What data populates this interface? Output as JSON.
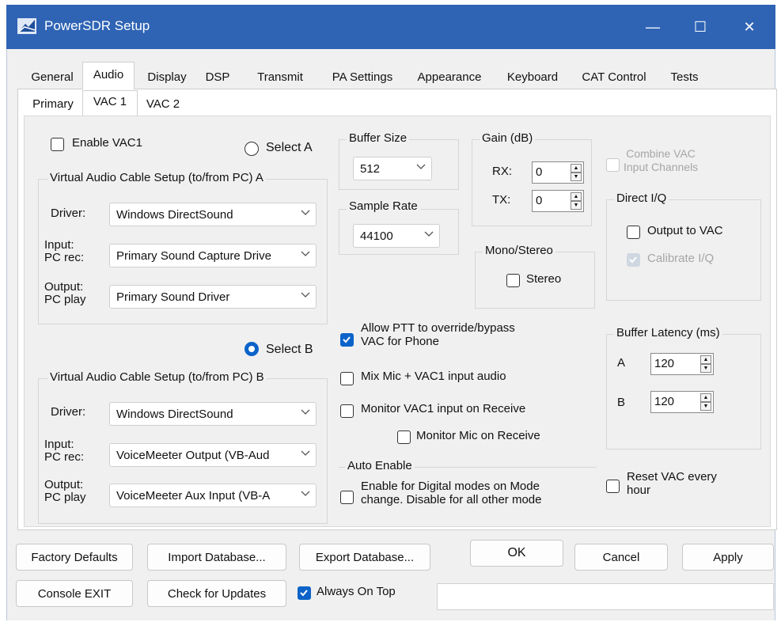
{
  "window": {
    "title": "PowerSDR Setup",
    "minimize": "—",
    "maximize": "☐",
    "close": "✕"
  },
  "tabs": [
    "General",
    "Audio",
    "Display",
    "DSP",
    "Transmit",
    "PA Settings",
    "Appearance",
    "Keyboard",
    "CAT Control",
    "Tests"
  ],
  "subtabs": [
    "Primary",
    "VAC 1",
    "VAC 2"
  ],
  "enable_vac1": "Enable VAC1",
  "select_a": "Select A",
  "select_b": "Select B",
  "setup_a": {
    "title": "Virtual Audio Cable Setup (to/from PC)  A",
    "driver_label": "Driver:",
    "driver_value": "Windows DirectSound",
    "input_label1": "Input:",
    "input_label2": "PC rec:",
    "input_value": "Primary Sound Capture Drive",
    "output_label1": "Output:",
    "output_label2": "PC play",
    "output_value": "Primary Sound Driver"
  },
  "setup_b": {
    "title": "Virtual Audio Cable Setup (to/from PC)  B",
    "driver_label": "Driver:",
    "driver_value": "Windows DirectSound",
    "input_label1": "Input:",
    "input_label2": "PC rec:",
    "input_value": "VoiceMeeter Output (VB-Aud",
    "output_label1": "Output:",
    "output_label2": "PC play",
    "output_value": "VoiceMeeter Aux Input (VB-A"
  },
  "buffer_size": {
    "label": "Buffer Size",
    "value": "512"
  },
  "sample_rate": {
    "label": "Sample Rate",
    "value": "44100"
  },
  "gain": {
    "label": "Gain (dB)",
    "rx_label": "RX:",
    "rx_value": "0",
    "tx_label": "TX:",
    "tx_value": "0"
  },
  "combine": {
    "line1": "Combine VAC",
    "line2": "Input Channels"
  },
  "direct_iq": {
    "label": "Direct I/Q",
    "output_to_vac": "Output to VAC",
    "calibrate": "Calibrate I/Q"
  },
  "mono_stereo": {
    "label": "Mono/Stereo",
    "stereo": "Stereo"
  },
  "allow_ptt": {
    "line1": "Allow PTT to override/bypass",
    "line2": "VAC for Phone"
  },
  "mix_mic": "Mix Mic + VAC1 input audio",
  "monitor_vac1": "Monitor VAC1 input on Receive",
  "monitor_mic": "Monitor Mic on Receive",
  "buffer_latency": {
    "label": "Buffer Latency (ms)",
    "a_label": "A",
    "a_value": "120",
    "b_label": "B",
    "b_value": "120"
  },
  "auto_enable": {
    "label": "Auto Enable",
    "line1": "Enable for Digital modes on Mode",
    "line2": "change.  Disable for all other mode"
  },
  "reset_vac": {
    "line1": "Reset VAC every",
    "line2": "hour"
  },
  "buttons": {
    "factory_defaults": "Factory Defaults",
    "import_db": "Import Database...",
    "export_db": "Export Database...",
    "ok": "OK",
    "cancel": "Cancel",
    "apply": "Apply",
    "console_exit": "Console EXIT",
    "check_updates": "Check for Updates",
    "always_on_top": "Always On Top"
  },
  "colors": {
    "titlebar": "#2f64b5",
    "accent": "#0b63c9",
    "client_bg": "#f0f0f0"
  }
}
